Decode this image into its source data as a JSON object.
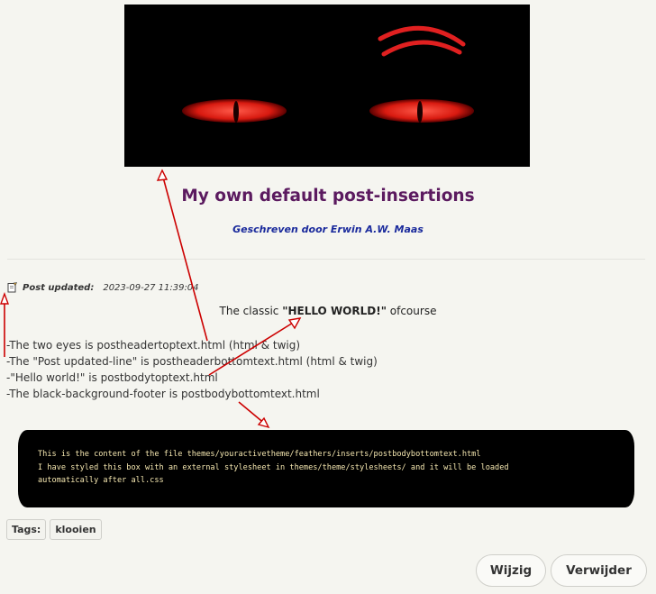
{
  "post": {
    "title": "My own default post-insertions",
    "byline": "Geschreven door Erwin A.W. Maas",
    "updated_label": "Post updated:",
    "updated_time": "2023-09-27 11:39:04",
    "hello_prefix": "The classic ",
    "hello_strong": "\"HELLO WORLD!\"",
    "hello_suffix": " ofcourse",
    "notes": [
      "-The two eyes is postheadertoptext.html (html & twig)",
      "-The \"Post updated-line\" is postheaderbottomtext.html (html & twig)",
      "-\"Hello world!\" is postbodytoptext.html",
      "-The black-background-footer is postbodybottomtext.html"
    ],
    "code_lines": [
      "This is the content of the file themes/youractivetheme/feathers/inserts/postbodybottomtext.html",
      "I have styled this box with an external stylesheet in themes/theme/stylesheets/ and it will be loaded",
      "automatically after all.css"
    ]
  },
  "tags": {
    "label": "Tags:",
    "items": [
      "klooien"
    ]
  },
  "actions": {
    "edit": "Wijzig",
    "delete": "Verwijder"
  },
  "colors": {
    "title": "#5b1a5f",
    "byline": "#1a2a9c",
    "arrow": "#cc0000",
    "eye": "#e02020",
    "code_text": "#f5e7b0"
  }
}
